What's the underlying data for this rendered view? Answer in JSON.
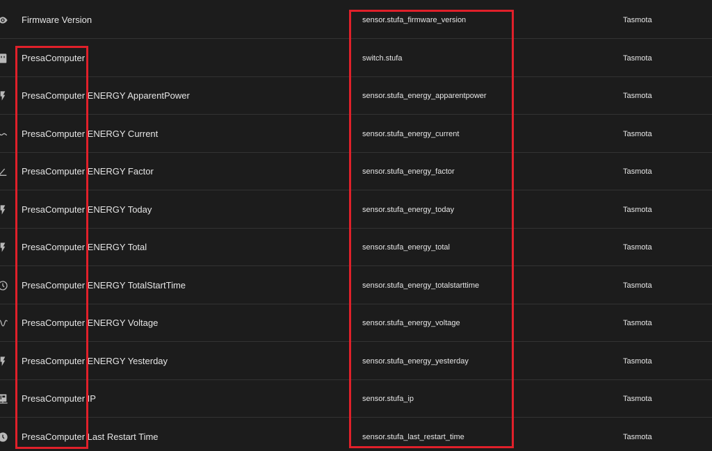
{
  "table": {
    "rows": [
      {
        "icon": "eye-icon",
        "name": "Firmware Version",
        "entity_id": "sensor.stufa_firmware_version",
        "integration": "Tasmota"
      },
      {
        "icon": "power-socket-icon",
        "name": "PresaComputer",
        "entity_id": "switch.stufa",
        "integration": "Tasmota"
      },
      {
        "icon": "flash-icon",
        "name": "PresaComputer ENERGY ApparentPower",
        "entity_id": "sensor.stufa_energy_apparentpower",
        "integration": "Tasmota"
      },
      {
        "icon": "current-ac-icon",
        "name": "PresaComputer ENERGY Current",
        "entity_id": "sensor.stufa_energy_current",
        "integration": "Tasmota"
      },
      {
        "icon": "angle-acute-icon",
        "name": "PresaComputer ENERGY Factor",
        "entity_id": "sensor.stufa_energy_factor",
        "integration": "Tasmota"
      },
      {
        "icon": "flash-icon",
        "name": "PresaComputer ENERGY Today",
        "entity_id": "sensor.stufa_energy_today",
        "integration": "Tasmota"
      },
      {
        "icon": "flash-icon",
        "name": "PresaComputer ENERGY Total",
        "entity_id": "sensor.stufa_energy_total",
        "integration": "Tasmota"
      },
      {
        "icon": "clock-icon",
        "name": "PresaComputer ENERGY TotalStartTime",
        "entity_id": "sensor.stufa_energy_totalstarttime",
        "integration": "Tasmota"
      },
      {
        "icon": "sine-wave-icon",
        "name": "PresaComputer ENERGY Voltage",
        "entity_id": "sensor.stufa_energy_voltage",
        "integration": "Tasmota"
      },
      {
        "icon": "flash-icon",
        "name": "PresaComputer ENERGY Yesterday",
        "entity_id": "sensor.stufa_energy_yesterday",
        "integration": "Tasmota"
      },
      {
        "icon": "ip-network-icon",
        "name": "PresaComputer IP",
        "entity_id": "sensor.stufa_ip",
        "integration": "Tasmota"
      },
      {
        "icon": "clock-filled-icon",
        "name": "PresaComputer Last Restart Time",
        "entity_id": "sensor.stufa_last_restart_time",
        "integration": "Tasmota"
      }
    ]
  },
  "colors": {
    "background": "#1c1c1c",
    "divider": "#333333",
    "text": "#e6e6e6",
    "icon": "#b8b8b8",
    "highlight": "#e0202a"
  }
}
